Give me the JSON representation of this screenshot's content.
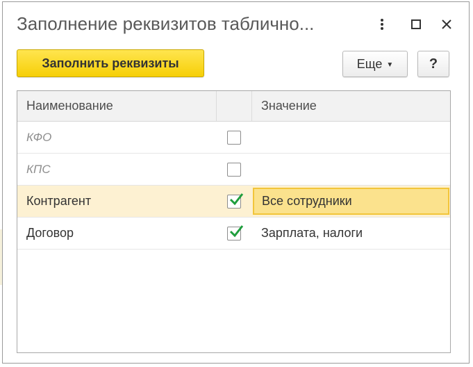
{
  "window": {
    "title": "Заполнение реквизитов таблично..."
  },
  "toolbar": {
    "fill_label": "Заполнить реквизиты",
    "more_label": "Еще",
    "help_label": "?"
  },
  "table": {
    "columns": [
      "Наименование",
      "",
      "Значение"
    ],
    "rows": [
      {
        "name": "КФО",
        "checked": false,
        "value": "",
        "disabled": true,
        "selected": false
      },
      {
        "name": "КПС",
        "checked": false,
        "value": "",
        "disabled": true,
        "selected": false
      },
      {
        "name": "Контрагент",
        "checked": true,
        "value": "Все сотрудники",
        "disabled": false,
        "selected": true
      },
      {
        "name": "Договор",
        "checked": true,
        "value": "Зарплата, налоги",
        "disabled": false,
        "selected": false
      }
    ]
  },
  "colors": {
    "accent": "#f6cf07",
    "check": "#1f9e3d",
    "selected_row": "#fdf1d2",
    "selected_cell": "#fbe28d"
  },
  "icons": {
    "more_menu": "vertical-dots-icon",
    "maximize": "maximize-icon",
    "close": "close-icon",
    "caret": "caret-down-icon",
    "check": "check-icon"
  }
}
